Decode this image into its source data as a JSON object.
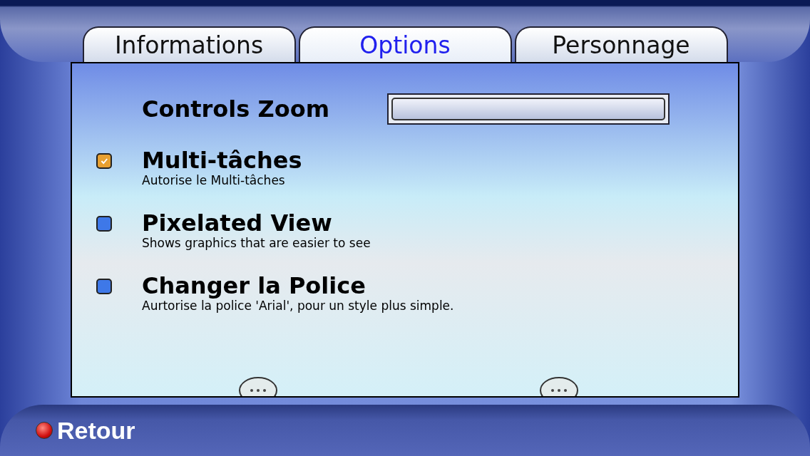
{
  "tabs": [
    {
      "label": "Informations",
      "selected": false
    },
    {
      "label": "Options",
      "selected": true
    },
    {
      "label": "Personnage",
      "selected": false
    }
  ],
  "zoom_control": {
    "label": "Controls Zoom"
  },
  "options": [
    {
      "title": "Multi-tâches",
      "description": "Autorise le Multi-tâches",
      "checked": true
    },
    {
      "title": "Pixelated View",
      "description": "Shows graphics that are easier to see",
      "checked": false
    },
    {
      "title": "Changer la Police",
      "description": "Aurtorise la police 'Arial', pour un style plus simple.",
      "checked": false
    }
  ],
  "back_button": {
    "label": "Retour"
  }
}
